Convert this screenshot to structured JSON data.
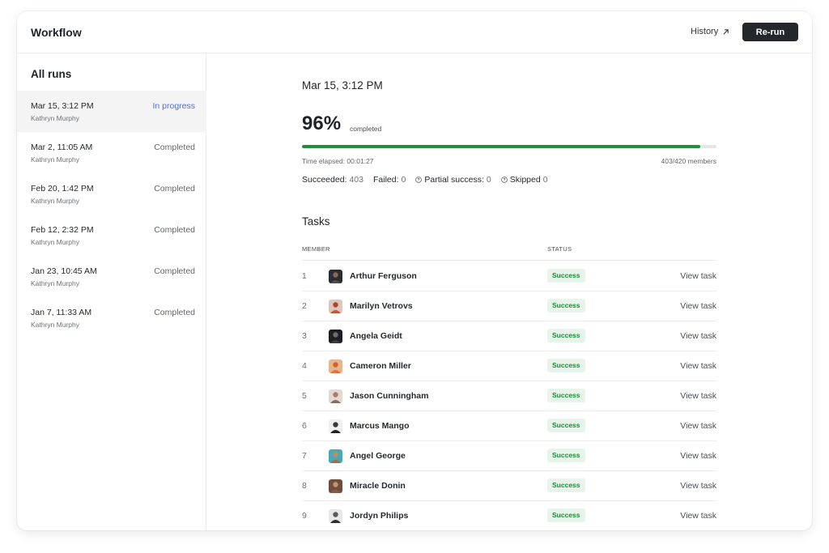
{
  "header": {
    "title": "Workflow",
    "history_label": "History",
    "rerun_label": "Re-run"
  },
  "sidebar": {
    "title": "All runs",
    "runs": [
      {
        "date": "Mar 15, 3:12 PM",
        "user": "Kathryn Murphy",
        "status": "In progress"
      },
      {
        "date": "Mar 2, 11:05 AM",
        "user": "Kathryn Murphy",
        "status": "Completed"
      },
      {
        "date": "Feb 20, 1:42 PM",
        "user": "Kathryn Murphy",
        "status": "Completed"
      },
      {
        "date": "Feb 12, 2:32 PM",
        "user": "Kathryn Murphy",
        "status": "Completed"
      },
      {
        "date": "Jan 23, 10:45 AM",
        "user": "Kathryn Murphy",
        "status": "Completed"
      },
      {
        "date": "Jan 7, 11:33 AM",
        "user": "Kathryn Murphy",
        "status": "Completed"
      }
    ]
  },
  "run": {
    "heading": "Mar 15, 3:12 PM",
    "percent": "96%",
    "percent_label": "completed",
    "progress_fraction": 0.96,
    "elapsed": "Time elapsed: 00:01:27",
    "members": "403/420 members",
    "stats": {
      "succeeded_label": "Succeeded:",
      "succeeded": "403",
      "failed_label": "Failed:",
      "failed": "0",
      "partial_label": "Partial success:",
      "partial": "0",
      "skipped_label": "Skipped",
      "skipped": "0"
    }
  },
  "tasks": {
    "title": "Tasks",
    "col_member": "MEMBER",
    "col_status": "STATUS",
    "view_label": "View task",
    "rows": [
      {
        "idx": "1",
        "name": "Arthur Ferguson",
        "status": "Success"
      },
      {
        "idx": "2",
        "name": "Marilyn Vetrovs",
        "status": "Success"
      },
      {
        "idx": "3",
        "name": "Angela Geidt",
        "status": "Success"
      },
      {
        "idx": "4",
        "name": "Cameron Miller",
        "status": "Success"
      },
      {
        "idx": "5",
        "name": "Jason Cunningham",
        "status": "Success"
      },
      {
        "idx": "6",
        "name": "Marcus Mango",
        "status": "Success"
      },
      {
        "idx": "7",
        "name": "Angel George",
        "status": "Success"
      },
      {
        "idx": "8",
        "name": "Miracle Donin",
        "status": "Success"
      },
      {
        "idx": "9",
        "name": "Jordyn Philips",
        "status": "Success"
      }
    ]
  },
  "colors": {
    "accent_dark": "#24272b",
    "in_progress": "#4f6fe0",
    "success_text": "#1d8a36",
    "success_bg": "#e7f4ea",
    "progress": "#1f8f3a"
  }
}
